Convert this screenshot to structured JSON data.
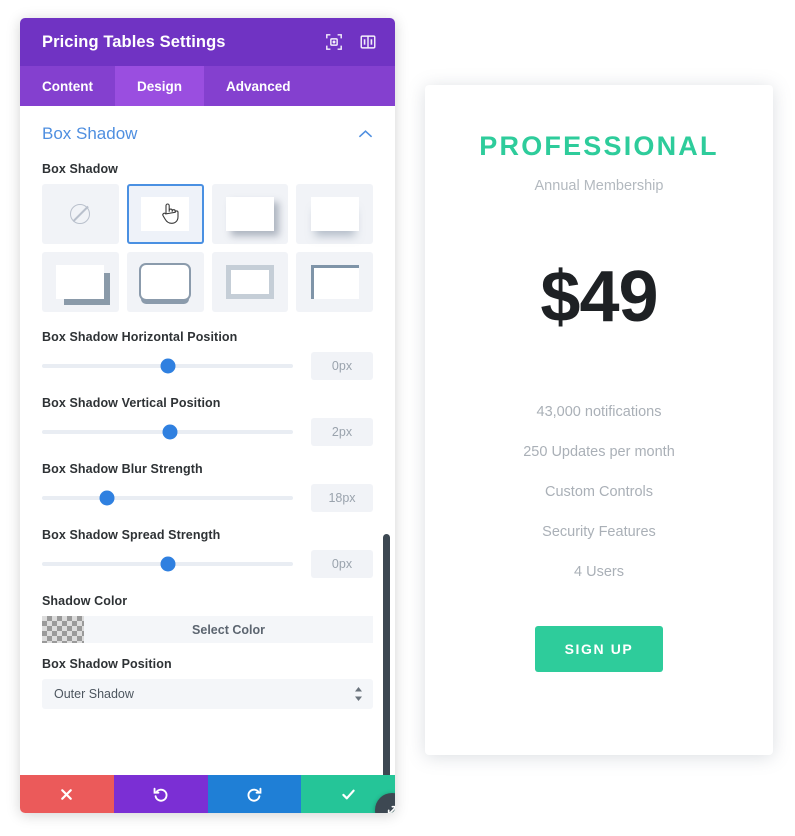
{
  "modal": {
    "title": "Pricing Tables Settings",
    "header_icons": [
      {
        "name": "focus-icon"
      },
      {
        "name": "split-view-icon"
      }
    ],
    "tabs": [
      {
        "label": "Content",
        "active": false
      },
      {
        "label": "Design",
        "active": true
      },
      {
        "label": "Advanced",
        "active": false
      }
    ],
    "section": {
      "title": "Box Shadow",
      "collapse_icon": "chevron-up-icon"
    },
    "box_shadow_field_label": "Box Shadow",
    "presets": [
      {
        "name": "preset-none",
        "selected": false
      },
      {
        "name": "preset-plain",
        "selected": true
      },
      {
        "name": "preset-drop",
        "selected": false
      },
      {
        "name": "preset-soft-bottom",
        "selected": false
      },
      {
        "name": "preset-corner",
        "selected": false
      },
      {
        "name": "preset-thick-outline",
        "selected": false
      },
      {
        "name": "preset-inset",
        "selected": false
      },
      {
        "name": "preset-inner-left",
        "selected": false
      }
    ],
    "sliders": [
      {
        "label": "Box Shadow Horizontal Position",
        "value": "0px",
        "percent": 50
      },
      {
        "label": "Box Shadow Vertical Position",
        "value": "2px",
        "percent": 51
      },
      {
        "label": "Box Shadow Blur Strength",
        "value": "18px",
        "percent": 26
      },
      {
        "label": "Box Shadow Spread Strength",
        "value": "0px",
        "percent": 50
      }
    ],
    "shadow_color": {
      "label": "Shadow Color",
      "button_label": "Select Color",
      "swatch": "transparent"
    },
    "shadow_position": {
      "label": "Box Shadow Position",
      "value": "Outer Shadow"
    },
    "actions": [
      {
        "name": "close-button",
        "icon": "x-icon",
        "color": "#eb5a5a"
      },
      {
        "name": "undo-button",
        "icon": "undo-icon",
        "color": "#7b2fd4"
      },
      {
        "name": "redo-button",
        "icon": "redo-icon",
        "color": "#1f7fd6"
      },
      {
        "name": "save-button",
        "icon": "checkmark-icon",
        "color": "#25c598"
      }
    ],
    "resize_handle_icon": "resize-diagonal-icon"
  },
  "pricing_card": {
    "package_title": "PROFESSIONAL",
    "subtitle": "Annual Membership",
    "price": "$49",
    "features": [
      "43,000 notifications",
      "250 Updates per month",
      "Custom Controls",
      "Security Features",
      "4 Users"
    ],
    "cta_label": "SIGN UP",
    "accent_color": "#2ecc9b"
  }
}
